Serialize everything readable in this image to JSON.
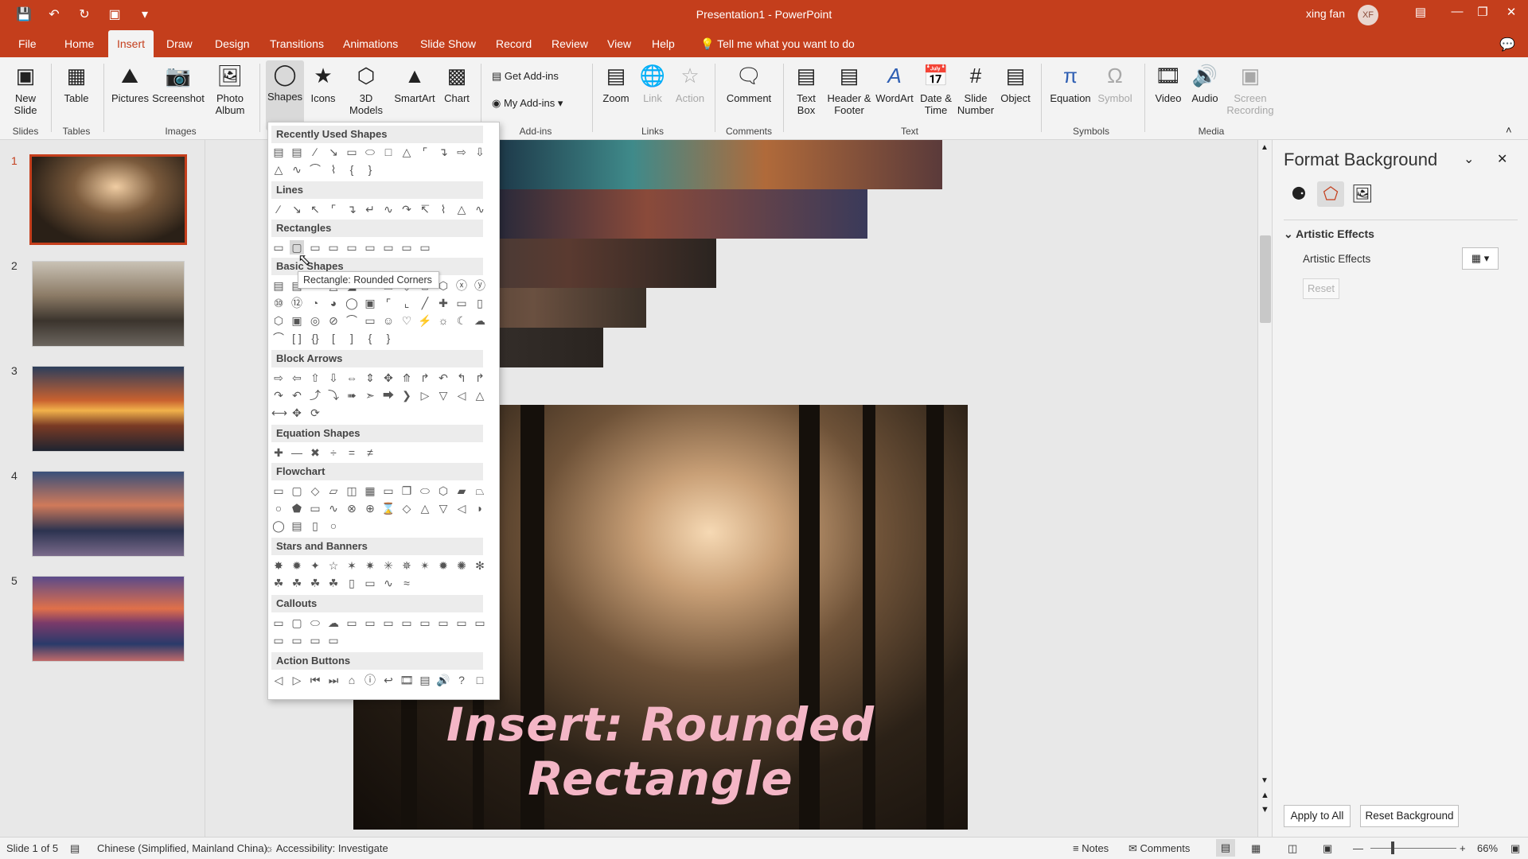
{
  "app": {
    "title": "Presentation1  -  PowerPoint",
    "user_name": "xing fan",
    "user_initials": "XF"
  },
  "qat": {
    "save_icon": "save-icon",
    "undo_icon": "undo-icon",
    "redo_icon": "redo-icon"
  },
  "tabs": [
    "File",
    "Home",
    "Insert",
    "Draw",
    "Design",
    "Transitions",
    "Animations",
    "Slide Show",
    "Record",
    "Review",
    "View",
    "Help"
  ],
  "active_tab": "Insert",
  "tell_me": "Tell me what you want to do",
  "ribbon": {
    "new_slide": "New Slide",
    "table": "Table",
    "pictures": "Pictures",
    "screenshot": "Screenshot",
    "photo_album": "Photo Album",
    "shapes": "Shapes",
    "icons": "Icons",
    "models_3d": "3D Models",
    "smartart": "SmartArt",
    "chart": "Chart",
    "get_addins": "Get Add-ins",
    "my_addins": "My Add-ins",
    "zoom": "Zoom",
    "link": "Link",
    "action": "Action",
    "comment": "Comment",
    "text_box": "Text Box",
    "header_footer": "Header & Footer",
    "wordart": "WordArt",
    "date_time": "Date & Time",
    "slide_number": "Slide Number",
    "object": "Object",
    "equation": "Equation",
    "symbol": "Symbol",
    "video": "Video",
    "audio": "Audio",
    "screen_recording": "Screen Recording"
  },
  "groups": {
    "slides": "Slides",
    "tables": "Tables",
    "images": "Images",
    "addins": "Add-ins",
    "links": "Links",
    "comments": "Comments",
    "text": "Text",
    "symbols": "Symbols",
    "media": "Media"
  },
  "slides": [
    "1",
    "2",
    "3",
    "4",
    "5"
  ],
  "shapes_menu": {
    "sections": [
      "Recently Used Shapes",
      "Lines",
      "Rectangles",
      "Basic Shapes",
      "Block Arrows",
      "Equation Shapes",
      "Flowchart",
      "Stars and Banners",
      "Callouts",
      "Action Buttons"
    ],
    "tooltip": "Rectangle: Rounded Corners"
  },
  "slide": {
    "caption": "Insert: Rounded Rectangle"
  },
  "format_pane": {
    "title": "Format Background",
    "section": "Artistic Effects",
    "effects_label": "Artistic Effects",
    "reset": "Reset",
    "apply_all": "Apply to All",
    "reset_background": "Reset Background"
  },
  "status": {
    "slide_count": "Slide 1 of 5",
    "language": "Chinese (Simplified, Mainland China)",
    "accessibility": "Accessibility: Investigate",
    "notes": "Notes",
    "comments": "Comments",
    "zoom": "66%"
  },
  "colors": {
    "accent": "#c43e1c",
    "caption": "#f4b6c6"
  }
}
